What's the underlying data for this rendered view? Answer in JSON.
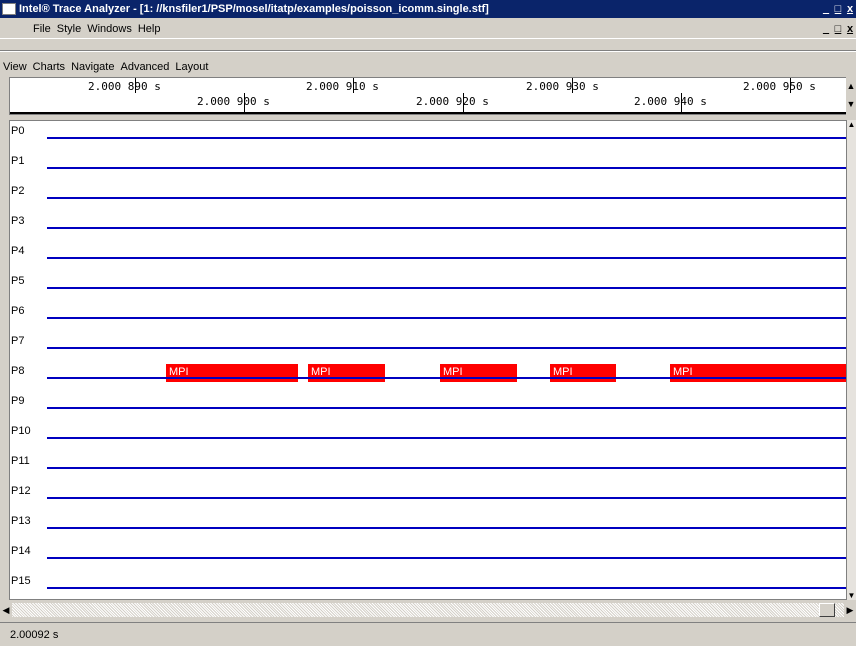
{
  "window": {
    "title": "Intel® Trace Analyzer - [1: //knsfiler1/PSP/mosel/itatp/examples/poisson_icomm.single.stf]",
    "minimize": "_",
    "restore": "̲❐",
    "close": "x"
  },
  "menubar1": {
    "items": [
      "File",
      "Style",
      "Windows",
      "Help"
    ]
  },
  "menubar2": {
    "items": [
      "View",
      "Charts",
      "Navigate",
      "Advanced",
      "Layout"
    ]
  },
  "ruler": {
    "top_labels": [
      "2.000 890 s",
      "2.000 910 s",
      "2.000 930 s",
      "2.000 950 s"
    ],
    "bottom_labels": [
      "2.000 900 s",
      "2.000 920 s",
      "2.000 940 s"
    ]
  },
  "processes": [
    "P0",
    "P1",
    "P2",
    "P3",
    "P4",
    "P5",
    "P6",
    "P7",
    "P8",
    "P9",
    "P10",
    "P11",
    "P12",
    "P13",
    "P14",
    "P15"
  ],
  "mpi_events": {
    "process": "P8",
    "labels": [
      "MPI",
      "MPI",
      "MPI",
      "MPI",
      "MPI"
    ]
  },
  "colors": {
    "process_line": "#0000c0",
    "mpi_event": "#ff0000",
    "title_bar": "#0a246a"
  },
  "status": {
    "time": "2.00092 s"
  }
}
